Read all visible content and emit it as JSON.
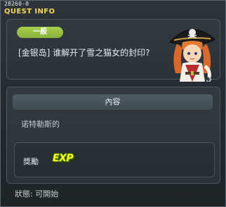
{
  "titlebar": {
    "quest_id": "28260-0",
    "title": "QUEST INFO",
    "close_icon": "close-icon"
  },
  "quest": {
    "category": "一般",
    "name": "[金银岛] 谁解开了雪之猫女的封印?",
    "npc_icon": "pirate-npc-portrait"
  },
  "content": {
    "header": "內容",
    "text": "诺特勒斯的"
  },
  "reward": {
    "label": "獎勵",
    "exp_label": "EXP"
  },
  "status": "狀態: 可開始",
  "colors": {
    "title": "#f3d65a",
    "badge": "#97c243",
    "exp": "#f6ff2a"
  }
}
